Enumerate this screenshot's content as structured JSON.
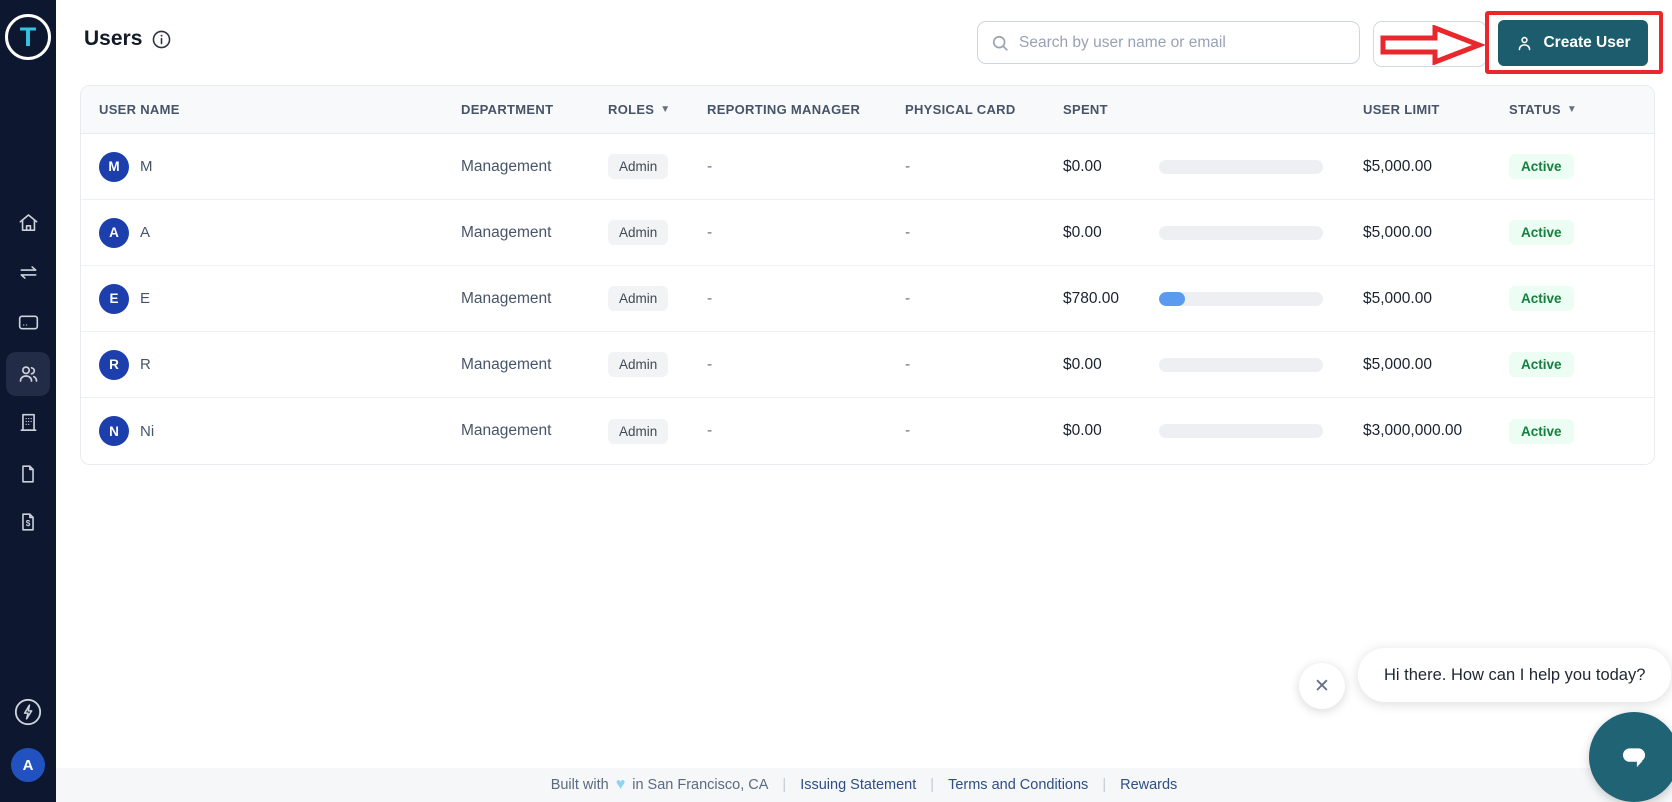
{
  "colors": {
    "accent_teal": "#1d5c6d",
    "chat_teal": "#206375",
    "annotation_red": "#e8282c",
    "avatar_blue": "#1d3fad",
    "progress_blue": "#5b9bef",
    "sidebar_navy": "#0e1730",
    "active_badge_green": "#15803d"
  },
  "sidebar": {
    "logo_letter": "T",
    "items": [
      {
        "label": "home",
        "icon": "home-icon",
        "active": false
      },
      {
        "label": "transactions",
        "icon": "transfers-icon",
        "active": false
      },
      {
        "label": "cards",
        "icon": "credit-card-icon",
        "active": false
      },
      {
        "label": "users",
        "icon": "users-icon",
        "active": true
      },
      {
        "label": "company",
        "icon": "building-icon",
        "active": false
      },
      {
        "label": "documents",
        "icon": "document-icon",
        "active": false
      },
      {
        "label": "billing",
        "icon": "invoice-dollar-icon",
        "active": false
      },
      {
        "label": "rewards",
        "icon": "power-bolt-icon",
        "active": false
      }
    ],
    "user_avatar_letter": "A"
  },
  "header": {
    "title": "Users",
    "search_placeholder": "Search by user name or email",
    "create_user_label": "Create User"
  },
  "table": {
    "columns": [
      {
        "label": "USER NAME",
        "sortable": false
      },
      {
        "label": "DEPARTMENT",
        "sortable": false
      },
      {
        "label": "ROLES",
        "sortable": true
      },
      {
        "label": "REPORTING MANAGER",
        "sortable": false
      },
      {
        "label": "PHYSICAL CARD",
        "sortable": false
      },
      {
        "label": "SPENT",
        "sortable": false
      },
      {
        "label": "USER LIMIT",
        "sortable": false
      },
      {
        "label": "STATUS",
        "sortable": true
      }
    ],
    "sort_caret": "▼",
    "rows": [
      {
        "avatar_letter": "M",
        "name": "M",
        "department": "Management",
        "role": "Admin",
        "reporting_manager": "-",
        "physical_card": "-",
        "spent": "$0.00",
        "spent_pct": 0,
        "user_limit": "$5,000.00",
        "status": "Active"
      },
      {
        "avatar_letter": "A",
        "name": "A",
        "department": "Management",
        "role": "Admin",
        "reporting_manager": "-",
        "physical_card": "-",
        "spent": "$0.00",
        "spent_pct": 0,
        "user_limit": "$5,000.00",
        "status": "Active"
      },
      {
        "avatar_letter": "E",
        "name": "E",
        "department": "Management",
        "role": "Admin",
        "reporting_manager": "-",
        "physical_card": "-",
        "spent": "$780.00",
        "spent_pct": 16,
        "user_limit": "$5,000.00",
        "status": "Active"
      },
      {
        "avatar_letter": "R",
        "name": "R",
        "department": "Management",
        "role": "Admin",
        "reporting_manager": "-",
        "physical_card": "-",
        "spent": "$0.00",
        "spent_pct": 0,
        "user_limit": "$5,000.00",
        "status": "Active"
      },
      {
        "avatar_letter": "N",
        "name": "Ni",
        "department": "Management",
        "role": "Admin",
        "reporting_manager": "-",
        "physical_card": "-",
        "spent": "$0.00",
        "spent_pct": 0,
        "user_limit": "$3,000,000.00",
        "status": "Active"
      }
    ]
  },
  "chat": {
    "message": "Hi there. How can I help you today?",
    "close_glyph": "✕"
  },
  "footer": {
    "built_prefix": "Built with",
    "heart": "♥",
    "built_suffix": "in San Francisco, CA",
    "separator": "|",
    "links": [
      "Issuing Statement",
      "Terms and Conditions",
      "Rewards"
    ]
  }
}
